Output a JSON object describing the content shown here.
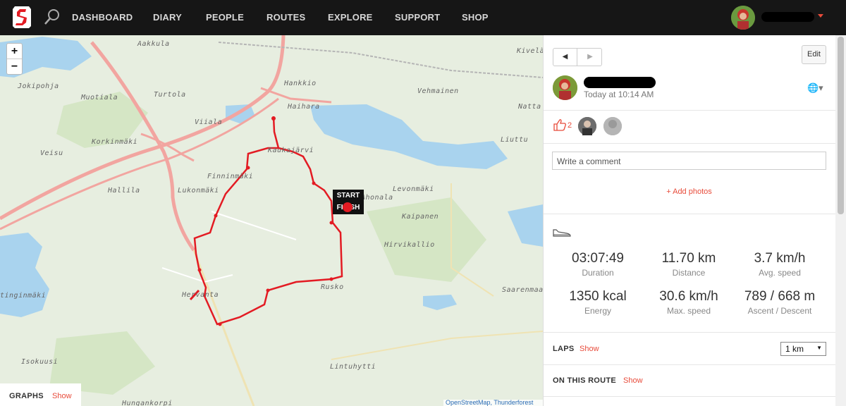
{
  "nav": {
    "items": [
      "DASHBOARD",
      "DIARY",
      "PEOPLE",
      "ROUTES",
      "EXPLORE",
      "SUPPORT",
      "SHOP"
    ]
  },
  "map": {
    "zoom_in": "+",
    "zoom_out": "−",
    "places": [
      "Aakkula",
      "Kivelä",
      "Hankkio",
      "Jokipohja",
      "Muotiala",
      "Turtola",
      "Vehmainen",
      "Natta",
      "Haihara",
      "Viiala",
      "Korkinmäki",
      "Kaukajärvi",
      "Liuttu",
      "Veisu",
      "Finninmäki",
      "Hallila",
      "Lukonmäki",
      "Levonmäki",
      "Kaipanen",
      "Hirvikallio",
      "Hervanta",
      "Rusko",
      "Saarenmaa",
      "tinginmäki",
      "Isokuusi",
      "Lintuhytti",
      "Hungankorpi",
      "Ahonala"
    ],
    "start_label": "START",
    "finish_label": "FINISH",
    "attribution": "OpenStreetMap, Thunderforest"
  },
  "graphs": {
    "label": "GRAPHS",
    "show": "Show"
  },
  "activity": {
    "edit": "Edit",
    "prev": "◀",
    "next": "▶",
    "time": "Today at 10:14 AM",
    "likes": "2",
    "comment_placeholder": "Write a comment",
    "add_photos": "+ Add photos",
    "stats": [
      {
        "value": "03:07:49",
        "label": "Duration"
      },
      {
        "value": "11.70 km",
        "label": "Distance"
      },
      {
        "value": "3.7 km/h",
        "label": "Avg. speed"
      },
      {
        "value": "1350 kcal",
        "label": "Energy"
      },
      {
        "value": "30.6 km/h",
        "label": "Max. speed"
      },
      {
        "value": "789 / 668 m",
        "label": "Ascent / Descent"
      }
    ],
    "laps_label": "LAPS",
    "laps_show": "Show",
    "laps_select": "1 km",
    "route_label": "ON THIS ROUTE",
    "route_show": "Show"
  },
  "colors": {
    "accent": "#e84b3a",
    "nav_bg": "#161616",
    "route": "#e31b23",
    "water": "#a9d3ee"
  }
}
